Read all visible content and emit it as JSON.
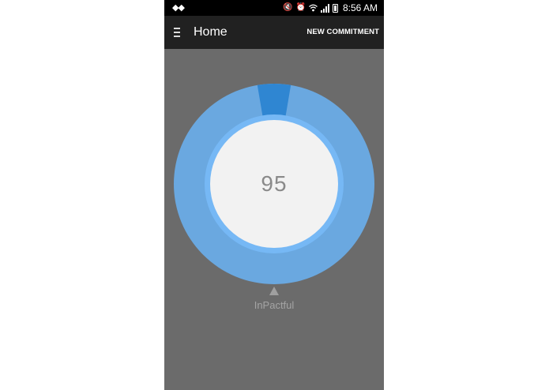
{
  "status_bar": {
    "left_icons": [
      "wave-icon"
    ],
    "right_icons": [
      "mute-icon",
      "alarm-icon",
      "wifi-icon",
      "signal-icon",
      "battery-icon"
    ],
    "time": "8:56 AM"
  },
  "app_bar": {
    "menu_icon": "hamburger-icon",
    "title": "Home",
    "action_label": "NEW COMMITMENT"
  },
  "gauge": {
    "score": "95",
    "colors": {
      "outer_ring": "#6aa8e0",
      "highlight_segment": "#2f86d2",
      "inner_ring": "#76b8f5",
      "center": "#f2f2f2"
    }
  },
  "brand": {
    "pointer_icon": "triangle-up-icon",
    "label": "InPactful"
  },
  "colors": {
    "background": "#6b6b6b",
    "app_bar": "#212121",
    "status_bar": "#000000"
  }
}
